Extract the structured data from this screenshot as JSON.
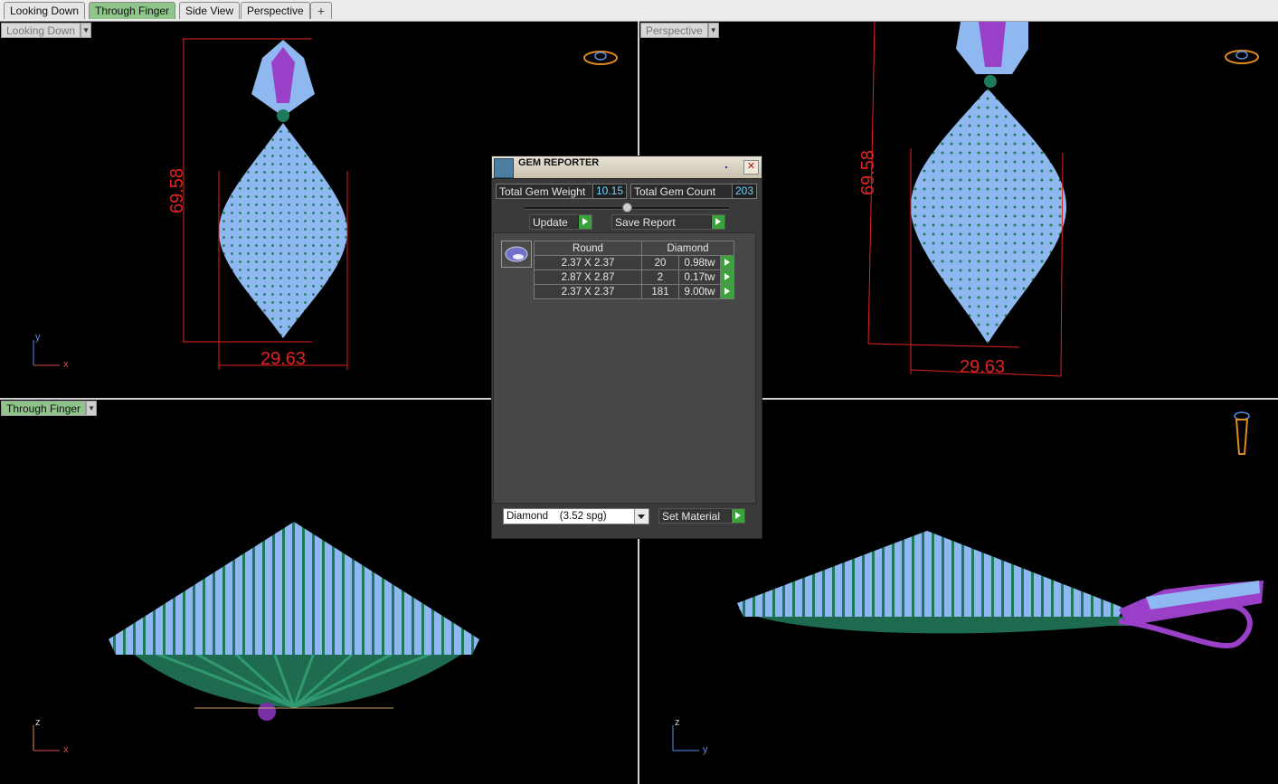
{
  "tabs": [
    {
      "label": "Looking Down",
      "active": false
    },
    {
      "label": "Through Finger",
      "active": true
    },
    {
      "label": "Side View",
      "active": false
    },
    {
      "label": "Perspective",
      "active": false
    }
  ],
  "add_tab_icon": "plus-icon",
  "viewports": {
    "top_left": {
      "label": "Looking Down",
      "height_dim": "69.58",
      "width_dim": "29.63",
      "axis": [
        "y",
        "x"
      ]
    },
    "top_right": {
      "label": "Perspective",
      "height_dim": "69.58",
      "width_dim": "29.63"
    },
    "bottom_left": {
      "label": "Through Finger",
      "axis": [
        "z",
        "x"
      ]
    },
    "bottom_right": {
      "axis": [
        "z",
        "y"
      ]
    }
  },
  "gem_reporter": {
    "title": "GEM REPORTER",
    "total_weight_label": "Total Gem Weight",
    "total_weight": "10.15",
    "total_count_label": "Total Gem Count",
    "total_count": "203",
    "update_label": "Update",
    "save_report_label": "Save Report",
    "table": {
      "headers": [
        "Round",
        "Diamond"
      ],
      "rows": [
        {
          "size": "2.37 X 2.37",
          "count": "20",
          "weight": "0.98tw"
        },
        {
          "size": "2.87 X 2.87",
          "count": "2",
          "weight": "0.17tw"
        },
        {
          "size": "2.37 X 2.37",
          "count": "181",
          "weight": "9.00tw"
        }
      ]
    },
    "material_select": "Diamond    (3.52 spg)",
    "set_material_label": "Set Material"
  },
  "colors": {
    "gem": "#8fb8f0",
    "prong": "#1f7a5c",
    "metal_purple": "#9a3fc8",
    "dimension": "#e32121",
    "active_tab": "#8fc58a"
  }
}
